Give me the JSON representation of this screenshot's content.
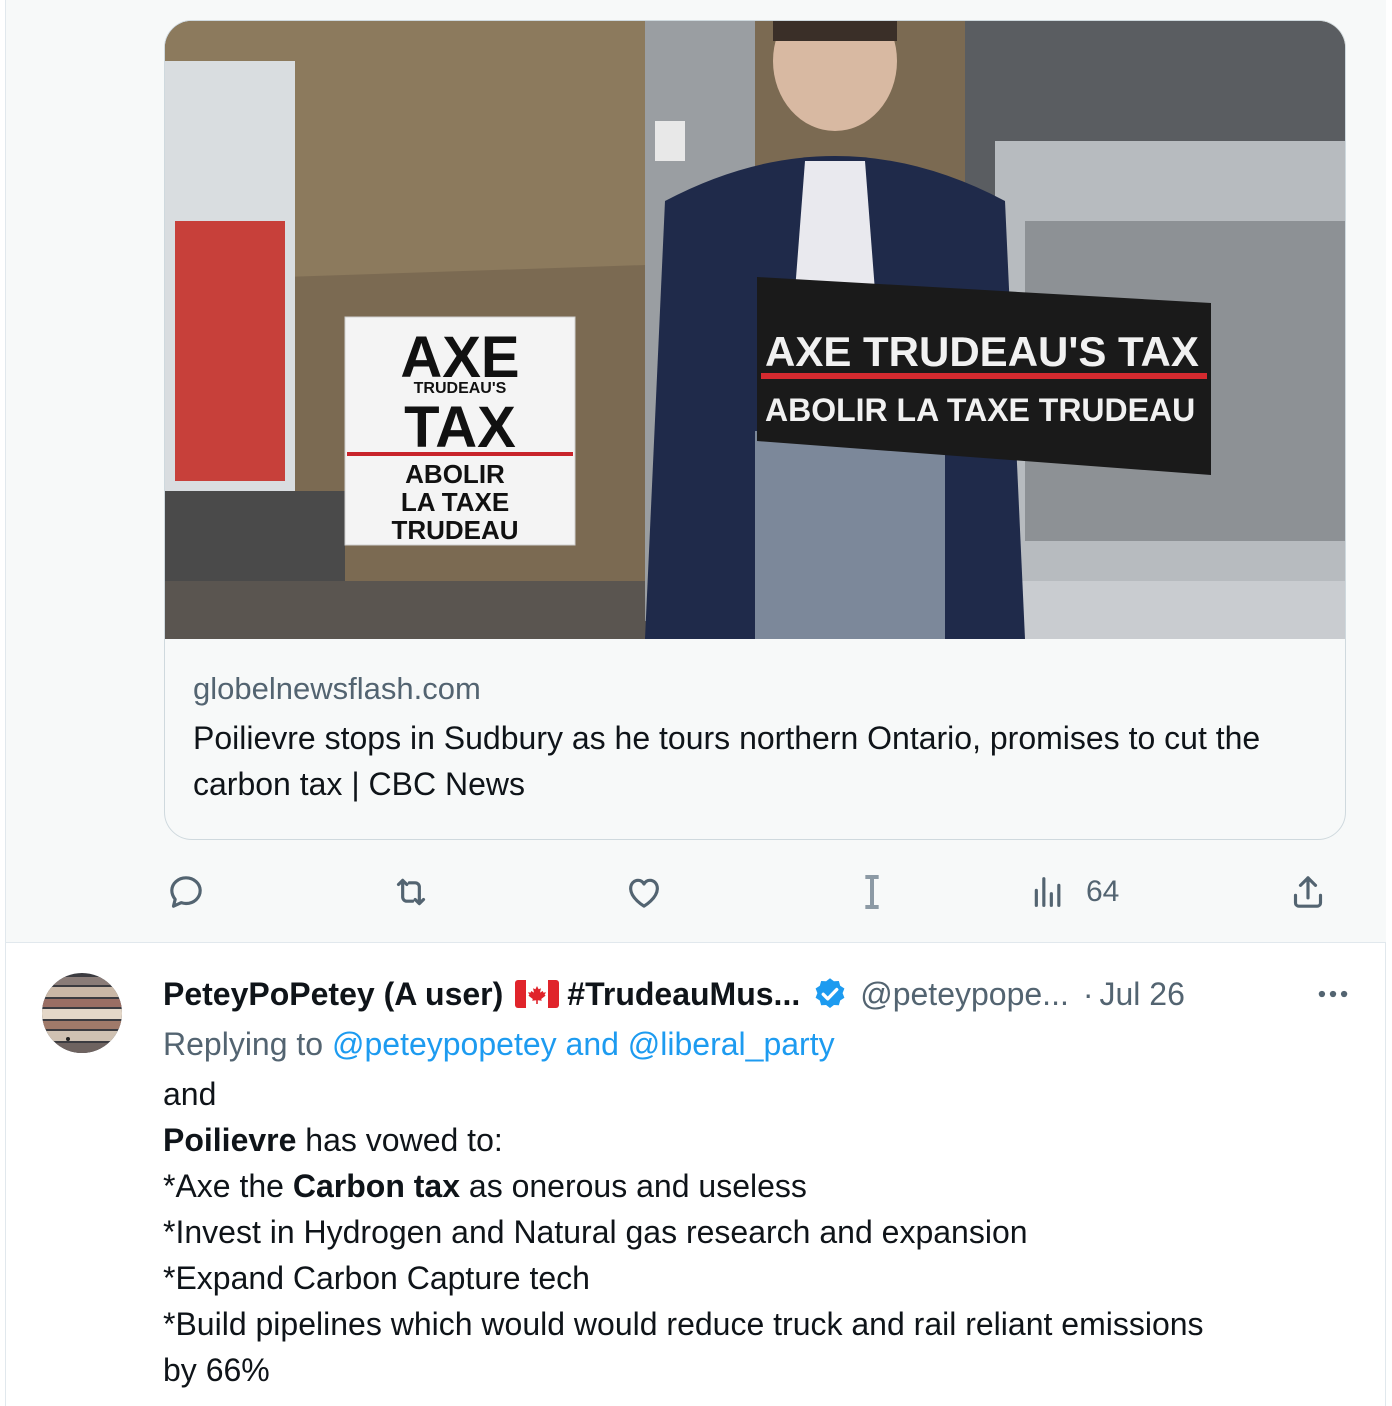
{
  "tweet1": {
    "card": {
      "photo_signs": {
        "left_sign_line1": "AXE",
        "left_sign_line2": "TRUDEAU'S",
        "left_sign_line3": "TAX",
        "left_sign_line4": "ABOLIR",
        "left_sign_line5": "LA TAXE",
        "left_sign_line6": "TRUDEAU",
        "podium_line1": "AXE TRUDEAU'S TAX",
        "podium_line2": "ABOLIR LA TAXE TRUDEAU"
      },
      "domain": "globelnewsflash.com",
      "title": "Poilievre stops in Sudbury as he tours northern Ontario, promises to cut the carbon tax | CBC News"
    },
    "actions": {
      "views_count": "64",
      "icons": [
        "reply-icon",
        "retweet-icon",
        "like-icon",
        "cursor-icon",
        "views-icon",
        "share-icon"
      ]
    }
  },
  "tweet2": {
    "display_name": "PeteyPoPetey (A user)",
    "name_suffix": "#TrudeauMus...",
    "handle": "@peteypope...",
    "separator": "·",
    "date": "Jul 26",
    "replying_prefix": "Replying to ",
    "replying_user1": "@peteypopetey",
    "replying_and": " and ",
    "replying_user2": "@liberal_party",
    "text": {
      "line1": "and",
      "line2_bold": "Poilievre",
      "line2_rest": " has vowed to:",
      "line3_pre": "*Axe the ",
      "line3_bold": "Carbon tax",
      "line3_post": " as onerous and useless",
      "line4": "*Invest in Hydrogen and Natural gas research and expansion",
      "line5": "*Expand Carbon Capture tech",
      "line6": "*Build pipelines which would would reduce truck and rail reliant emissions",
      "line7": "by 66%"
    }
  },
  "colors": {
    "link_blue": "#1d9bf0",
    "secondary_text": "#536471",
    "primary_text": "#0f1419",
    "background_gray": "#f7f9f9"
  }
}
